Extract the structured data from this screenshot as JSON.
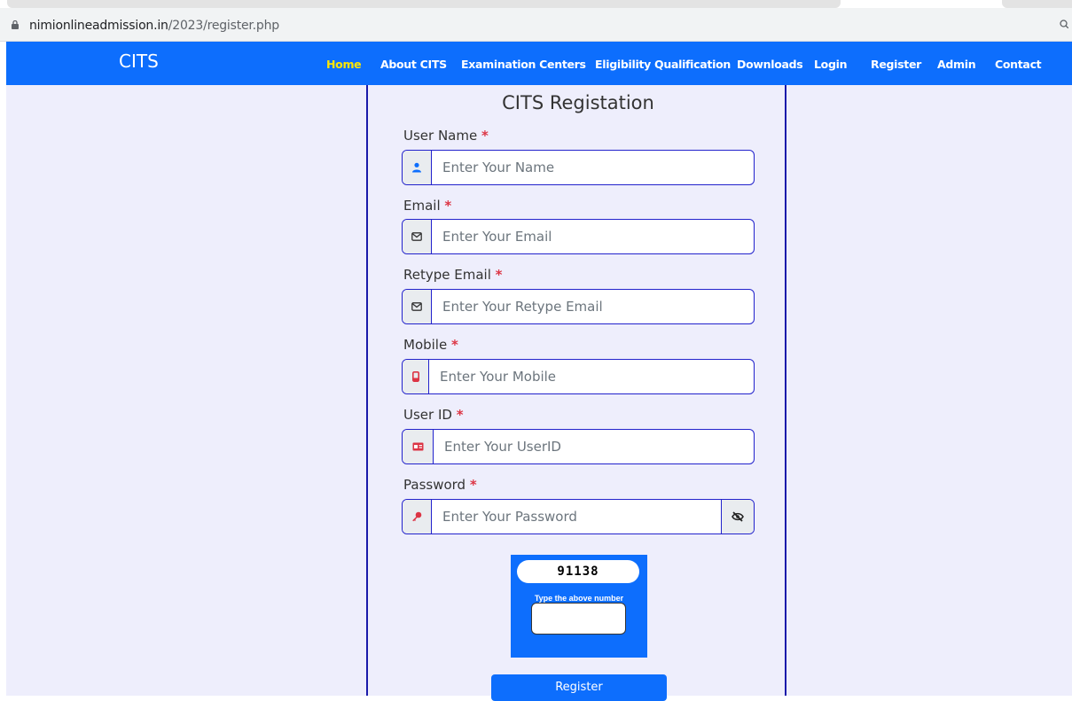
{
  "browser": {
    "url_domain": "nimionlineadmission.in",
    "url_path": "/2023/register.php"
  },
  "navbar": {
    "brand": "CITS",
    "items": [
      {
        "label": "Home",
        "active": true
      },
      {
        "label": "About CITS"
      },
      {
        "label": "Examination Centers"
      },
      {
        "label": "Eligibility Qualification"
      },
      {
        "label": "Downloads"
      },
      {
        "label": "Login"
      },
      {
        "label": "Register"
      },
      {
        "label": "Admin"
      },
      {
        "label": "Contact"
      }
    ]
  },
  "form": {
    "title": "CITS Registation",
    "required_mark": "*",
    "fields": [
      {
        "label": "User Name",
        "placeholder": "Enter Your Name",
        "icon": "user-icon"
      },
      {
        "label": "Email",
        "placeholder": "Enter Your Email",
        "icon": "envelope-icon"
      },
      {
        "label": "Retype Email",
        "placeholder": "Enter Your Retype Email",
        "icon": "envelope-icon"
      },
      {
        "label": "Mobile",
        "placeholder": "Enter Your Mobile",
        "icon": "mobile-icon"
      },
      {
        "label": "User ID",
        "placeholder": "Enter Your UserID",
        "icon": "id-card-icon"
      },
      {
        "label": "Password",
        "placeholder": "Enter Your Password",
        "icon": "key-icon",
        "toggle_icon": "eye-slash-icon"
      }
    ],
    "captcha": {
      "number": "91138",
      "instruction": "Type the above number"
    },
    "submit_label": "Register"
  },
  "colors": {
    "navbar": "#0d6efd",
    "active_nav": "#ffe600",
    "required": "#dc3545",
    "card_border": "#1a1aaa",
    "page_bg": "#eeeefc"
  }
}
